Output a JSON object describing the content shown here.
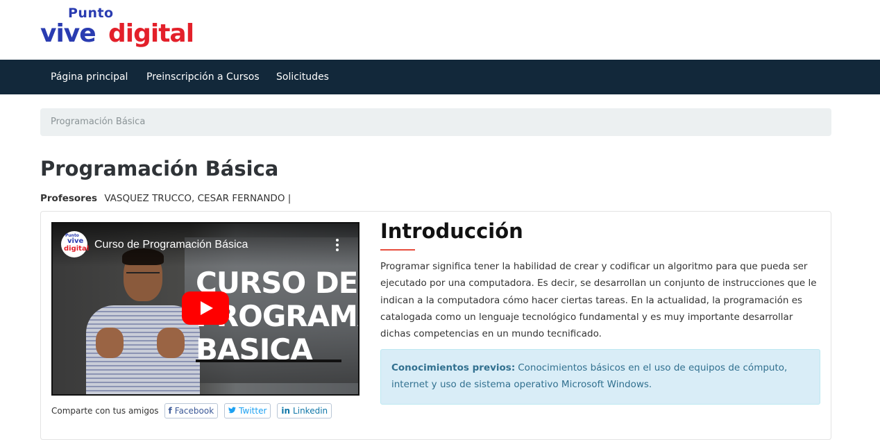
{
  "logo": {
    "top_text": "Punto",
    "word1": "vive",
    "word2": "digital"
  },
  "nav": {
    "items": [
      {
        "label": "Página principal"
      },
      {
        "label": "Preinscripción a Cursos"
      },
      {
        "label": "Solicitudes"
      }
    ]
  },
  "breadcrumb": {
    "current": "Programación Básica"
  },
  "course": {
    "title": "Programación Básica",
    "profesores_label": "Profesores",
    "profesores_value": "VASQUEZ TRUCCO, CESAR FERNANDO |"
  },
  "video": {
    "title": "Curso de Programación Básica",
    "overlay_line1": "CURSO DE",
    "overlay_line2": "PROGRAMACION",
    "overlay_line3": "BASICA",
    "channel_avatar_top": "Punto",
    "channel_avatar_mid": "vive",
    "channel_avatar_bottom": "digital",
    "play_color": "#ff0000"
  },
  "share": {
    "label": "Comparte con tus amigos",
    "buttons": [
      {
        "label": "Facebook",
        "icon": "facebook-icon"
      },
      {
        "label": "Twitter",
        "icon": "twitter-icon"
      },
      {
        "label": "Linkedin",
        "icon": "linkedin-icon"
      }
    ]
  },
  "intro": {
    "heading": "Introducción",
    "body": "Programar significa tener la habilidad de crear y codificar un algoritmo para que pueda ser ejecutado por una computadora. Es decir, se desarrollan un conjunto de instrucciones que le indican a la computadora cómo hacer ciertas tareas. En la actualidad, la programación es catalogada como un lenguaje tecnológico fundamental y es muy importante desarrollar dichas competencias en un mundo tecnificado."
  },
  "prerequisites": {
    "label": "Conocimientos previos:",
    "text": "Conocimientos básicos en el uso de equipos de cómputo, internet y uso de sistema operativo Microsoft Windows."
  },
  "colors": {
    "navbar": "#12283a",
    "logo_blue": "#2a3cb1",
    "logo_red": "#e3202a",
    "accent_underline": "#e74c3c",
    "alert_bg": "#d9edf7"
  }
}
